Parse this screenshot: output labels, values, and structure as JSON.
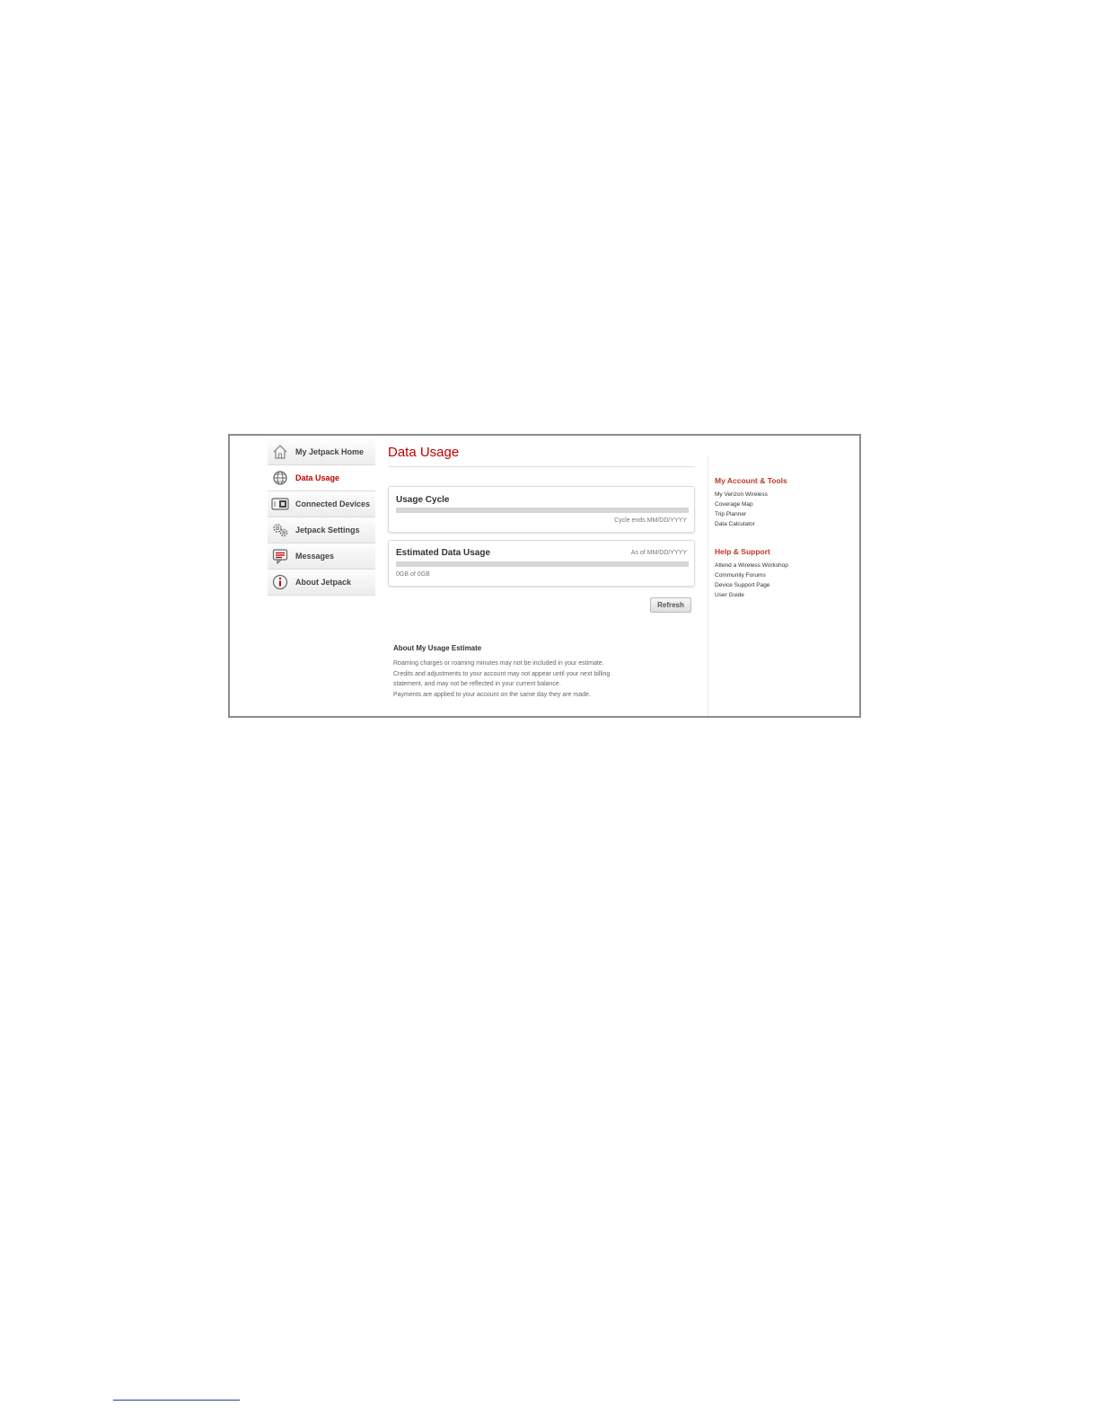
{
  "sidebar": {
    "items": [
      {
        "label": "My Jetpack Home",
        "icon": "home-icon"
      },
      {
        "label": "Data Usage",
        "icon": "globe-icon",
        "active": true
      },
      {
        "label": "Connected Devices",
        "icon": "devices-icon"
      },
      {
        "label": "Jetpack Settings",
        "icon": "gears-icon"
      },
      {
        "label": "Messages",
        "icon": "message-icon"
      },
      {
        "label": "About Jetpack",
        "icon": "info-icon"
      }
    ]
  },
  "main": {
    "title": "Data Usage",
    "usage_cycle": {
      "title": "Usage Cycle",
      "note": "Cycle ends MM/DD/YYYY",
      "progress": 0
    },
    "estimated_usage": {
      "title": "Estimated Data Usage",
      "as_of": "As of MM/DD/YYYY",
      "amount": "0GB of 0GB",
      "progress": 0
    },
    "refresh_label": "Refresh",
    "about": {
      "title": "About My Usage Estimate",
      "lines": [
        "Roaming charges or roaming minutes may not be included in your estimate.",
        "Credits and adjustments to your account may not appear until your next billing",
        "statement, and may not be reflected in your current balance.",
        "Payments are applied to your account on the same day they are made."
      ]
    }
  },
  "right_panel": {
    "account_tools": {
      "heading": "My Account & Tools",
      "links": [
        "My Verizon Wireless",
        "Coverage Map",
        "Trip Planner",
        "Data Calculator"
      ]
    },
    "help_support": {
      "heading": "Help & Support",
      "links": [
        "Attend a Wireless Workshop",
        "Community Forums",
        "Device Support Page",
        "User Guide"
      ]
    }
  },
  "colors": {
    "accent": "#c00000",
    "heading_red": "#c0392b",
    "frame_border": "#8c8c8c"
  }
}
